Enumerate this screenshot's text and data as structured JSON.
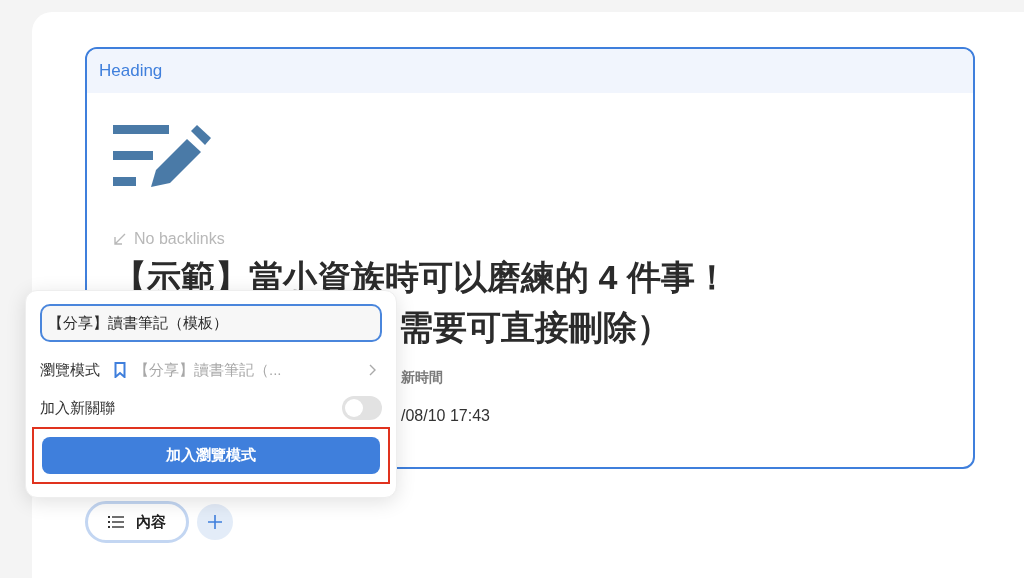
{
  "card": {
    "header": "Heading",
    "backlinks": "No backlinks",
    "title_line_1": "【示範】當小資族時可以磨練的 4 件事！",
    "title_line_2": "需要可直接刪除）",
    "property_label": "新時間",
    "property_value": "/08/10 17:43"
  },
  "popup": {
    "input_value": "【分享】讀書筆記（模板）",
    "browse_label": "瀏覽模式",
    "browse_value": "【分享】讀書筆記（...",
    "relation_label": "加入新關聯",
    "relation_on": false,
    "submit": "加入瀏覽模式",
    "highlighted": true
  },
  "tabs": [
    {
      "label": "內容",
      "selected": true
    }
  ]
}
